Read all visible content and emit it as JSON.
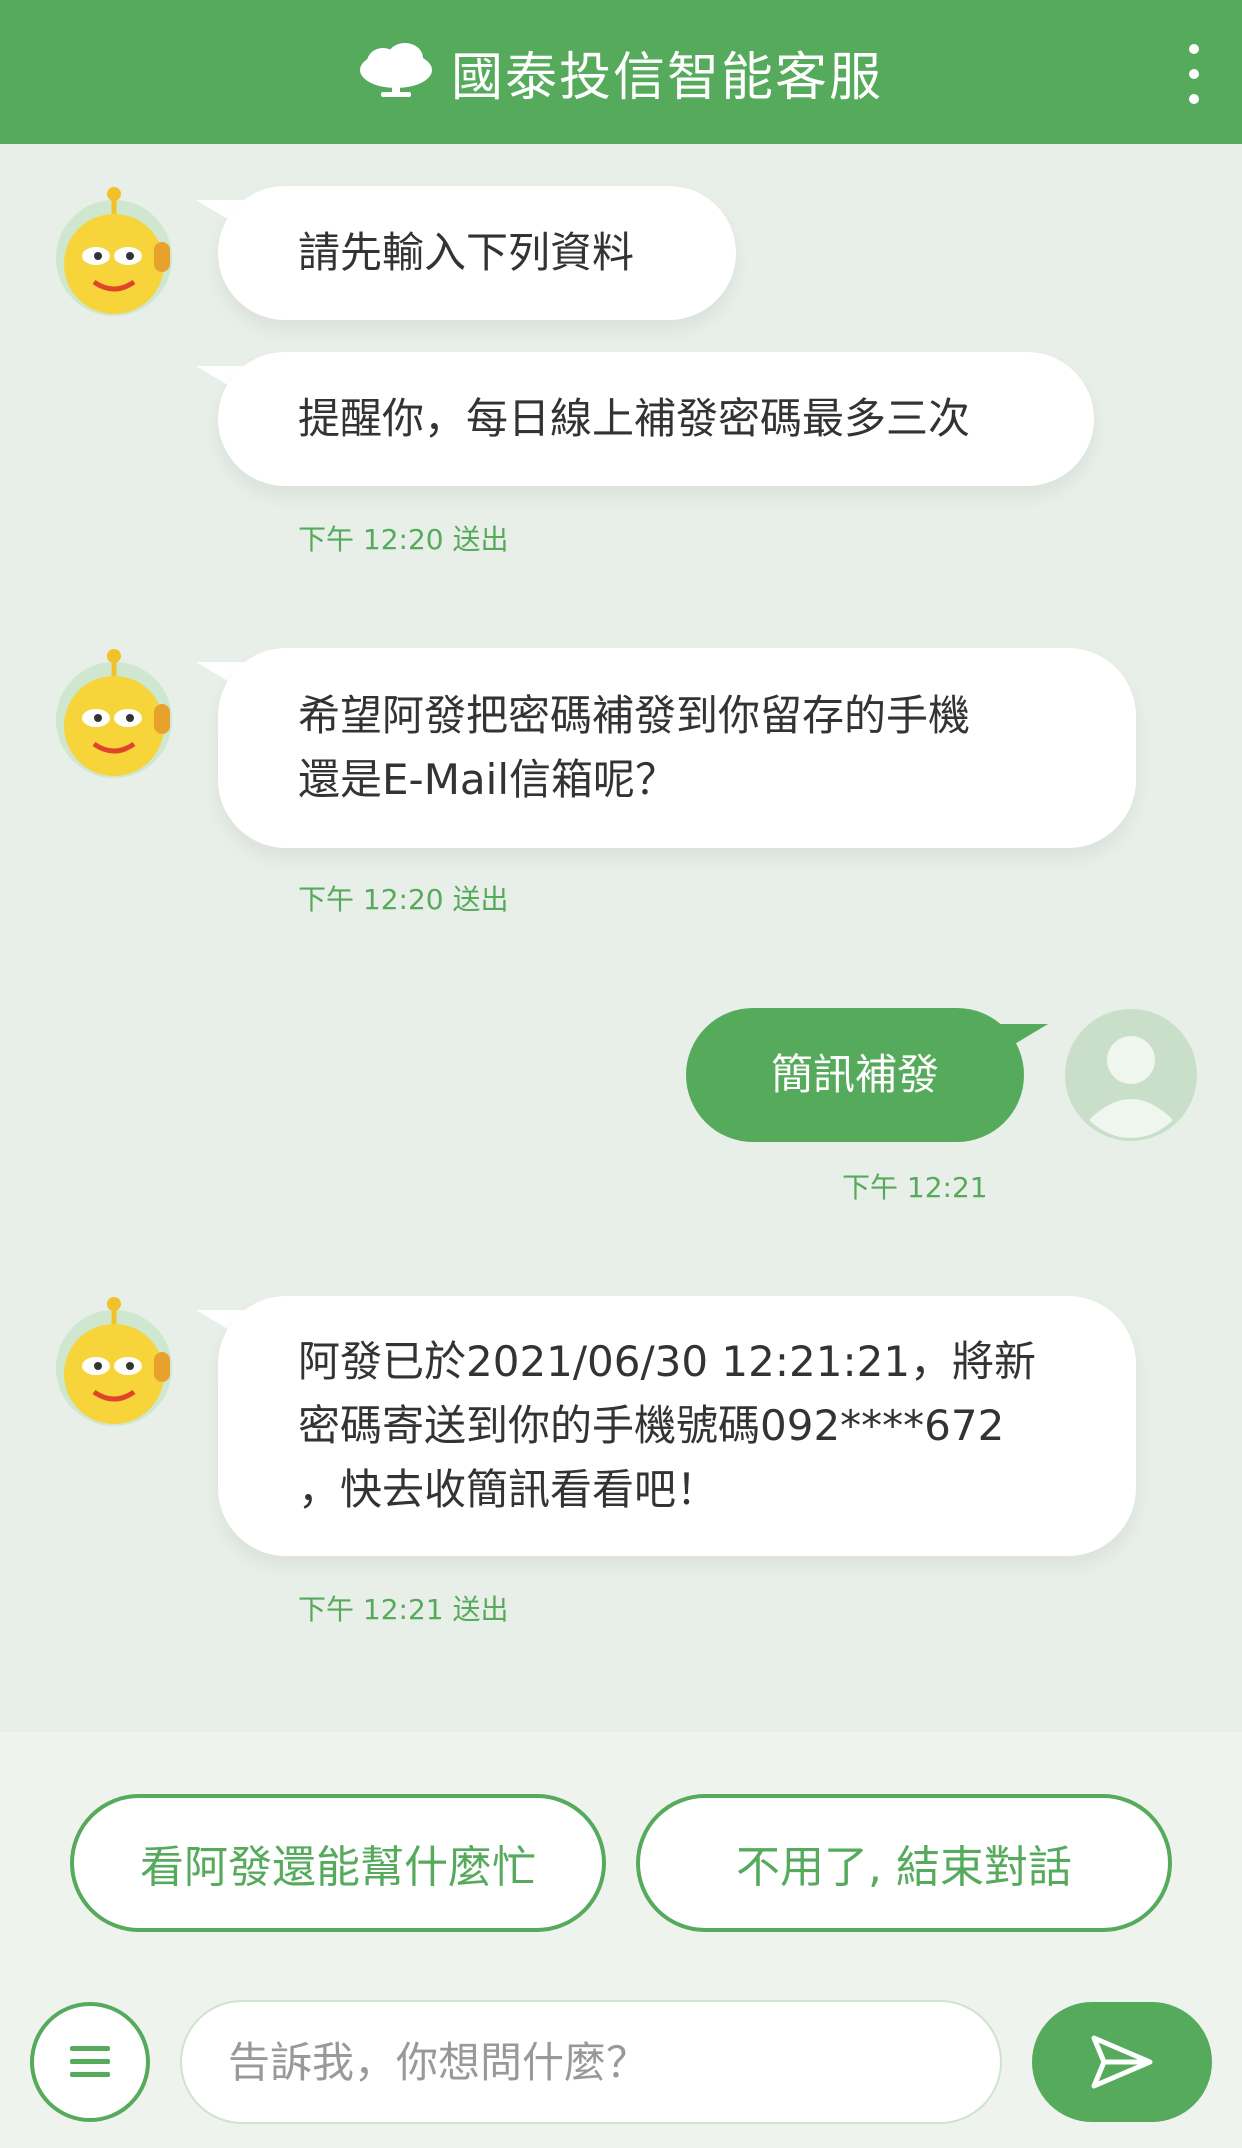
{
  "header": {
    "title": "國泰投信智能客服",
    "more_icon": "more-vertical-icon",
    "logo_icon": "tree-logo-icon"
  },
  "messages": [
    {
      "from": "bot",
      "text": "請先輸入下列資料"
    },
    {
      "from": "bot",
      "text": "提醒你，每日線上補發密碼最多三次",
      "meta": "下午 12:20 送出"
    },
    {
      "from": "bot",
      "text": "希望阿發把密碼補發到你留存的手機\n還是E-Mail信箱呢？",
      "meta": "下午 12:20 送出"
    },
    {
      "from": "user",
      "text": "簡訊補發",
      "meta": "下午 12:21"
    },
    {
      "from": "bot",
      "text": "阿發已於2021/06/30 12:21:21，將新\n密碼寄送到你的手機號碼092****672\n，快去收簡訊看看吧！",
      "meta": "下午 12:21 送出"
    }
  ],
  "quick_replies": [
    "看阿發還能幫什麼忙",
    "不用了, 結束對話"
  ],
  "composer": {
    "placeholder": "告訴我，你想問什麼？",
    "value": ""
  },
  "colors": {
    "brand": "#55aa5c",
    "background": "#e8efe8",
    "bubble": "#ffffff"
  }
}
